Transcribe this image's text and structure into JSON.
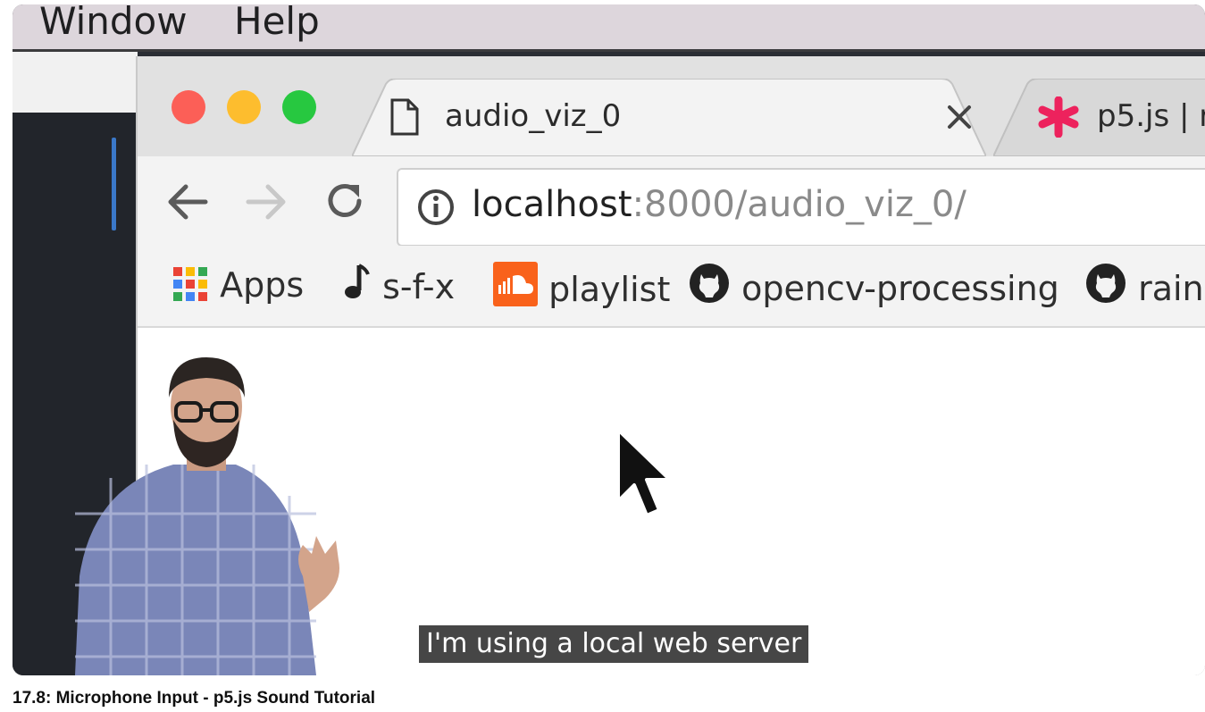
{
  "menubar": {
    "items": [
      "Window",
      "Help"
    ]
  },
  "browser": {
    "tabs": [
      {
        "title": "audio_viz_0",
        "active": true,
        "icon": "document-icon"
      },
      {
        "title": "p5.js | r",
        "active": false,
        "icon": "p5-asterisk-icon"
      }
    ],
    "address": {
      "host": "localhost",
      "path": ":8000/audio_viz_0/"
    },
    "bookmarks": [
      {
        "label": "Apps",
        "icon": "apps-grid-icon"
      },
      {
        "label": "s-f-x",
        "icon": "music-note-icon"
      },
      {
        "label": "playlist",
        "icon": "soundcloud-icon"
      },
      {
        "label": "opencv-processing",
        "icon": "github-icon"
      },
      {
        "label": "rainb",
        "icon": "github-icon"
      }
    ]
  },
  "colors": {
    "close": "#fc5f57",
    "minimize": "#fdbd2e",
    "zoom": "#27c840",
    "p5_accent": "#ed225d",
    "soundcloud": "#f9621b"
  },
  "caption": "I'm using a local web server",
  "video_title": "17.8: Microphone Input - p5.js Sound Tutorial"
}
